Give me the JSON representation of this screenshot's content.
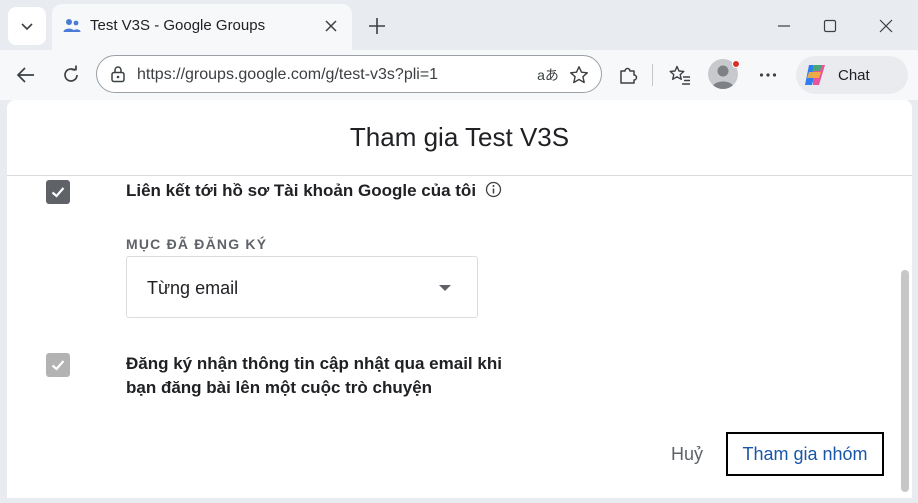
{
  "browser": {
    "tab_title": "Test V3S - Google Groups",
    "url": "https://groups.google.com/g/test-v3s?pli=1",
    "translate_glyph": "aあ",
    "chat_label": "Chat"
  },
  "dialog": {
    "title": "Tham gia Test V3S",
    "link_profile_label": "Liên kết tới hồ sơ Tài khoản Google của tôi",
    "subscription_section_label": "MỤC ĐÃ ĐĂNG KÝ",
    "subscription_value": "Từng email",
    "email_updates_line1": "Đăng ký nhận thông tin cập nhật qua email khi",
    "email_updates_line2": "bạn đăng bài lên một cuộc trò chuyện",
    "cancel_label": "Huỷ",
    "join_label": "Tham gia nhóm"
  },
  "colors": {
    "accent": "#1a56a8",
    "checkbox_checked": "#5f6368",
    "checkbox_disabled": "#b3b3b3",
    "notification_dot": "#d93025"
  }
}
